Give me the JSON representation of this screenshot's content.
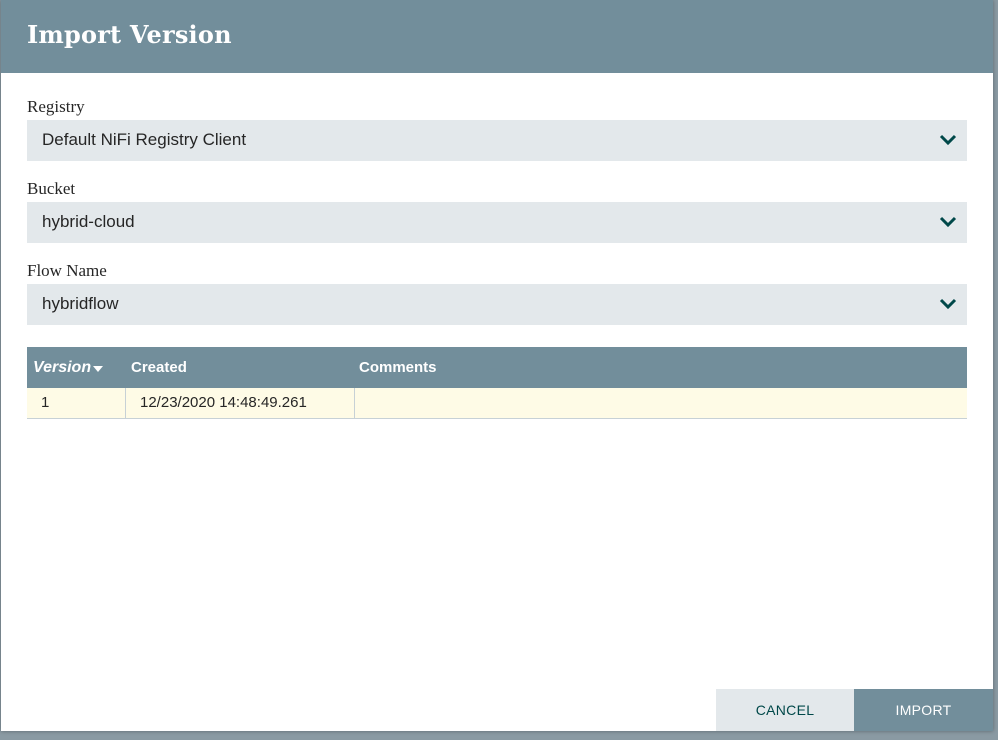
{
  "dialog": {
    "title": "Import Version"
  },
  "fields": {
    "registry": {
      "label": "Registry",
      "value": "Default NiFi Registry Client"
    },
    "bucket": {
      "label": "Bucket",
      "value": "hybrid-cloud"
    },
    "flow_name": {
      "label": "Flow Name",
      "value": "hybridflow"
    }
  },
  "grid": {
    "columns": [
      "Version",
      "Created",
      "Comments"
    ],
    "sort": {
      "column": "Version",
      "direction": "descending"
    },
    "rows": [
      {
        "version": "1",
        "created": "12/23/2020 14:48:49.261",
        "comments": ""
      }
    ]
  },
  "buttons": {
    "cancel": "CANCEL",
    "import": "IMPORT"
  },
  "icons": {
    "dropdown": "chevron-down-icon",
    "sort": "caret-down-icon"
  },
  "colors": {
    "header": "#728e9b",
    "field_bg": "#e3e8eb",
    "selected_row": "#fefbe6",
    "chevron": "#004849"
  }
}
